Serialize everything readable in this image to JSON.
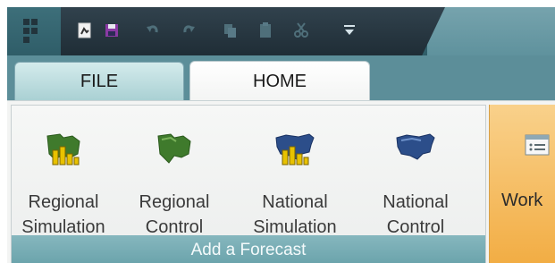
{
  "qat": {
    "buttons": [
      {
        "name": "app-grip-icon"
      },
      {
        "name": "open-icon"
      },
      {
        "name": "save-icon"
      },
      {
        "name": "undo-icon",
        "disabled": true
      },
      {
        "name": "redo-icon",
        "disabled": true
      },
      {
        "name": "copy-icon",
        "disabled": true
      },
      {
        "name": "paste-icon",
        "disabled": true
      },
      {
        "name": "cut-icon",
        "disabled": true
      },
      {
        "name": "customize-dropdown-icon"
      }
    ]
  },
  "tabs": [
    {
      "label": "FILE"
    },
    {
      "label": "HOME"
    }
  ],
  "ribbon": {
    "groups": [
      {
        "caption": "Add a Forecast",
        "buttons": [
          {
            "line1": "Regional",
            "line2": "Simulation",
            "icon": "regional-simulation-icon"
          },
          {
            "line1": "Regional",
            "line2": "Control",
            "icon": "regional-control-icon"
          },
          {
            "line1": "National",
            "line2": "Simulation",
            "icon": "national-simulation-icon"
          },
          {
            "line1": "National",
            "line2": "Control",
            "icon": "national-control-icon"
          }
        ]
      },
      {
        "caption": "",
        "buttons": [
          {
            "line1": "Work",
            "icon": "workspace-icon"
          }
        ]
      }
    ]
  },
  "colors": {
    "ribbon_caption": "#79adb5",
    "tab_active": "#ffffff",
    "qat_background": "#2f5d68",
    "highlight_group": "#f2ad44",
    "icon_green": "#3f7a2c",
    "icon_blue": "#2c4e8a",
    "icon_bars": "#e8c200"
  }
}
